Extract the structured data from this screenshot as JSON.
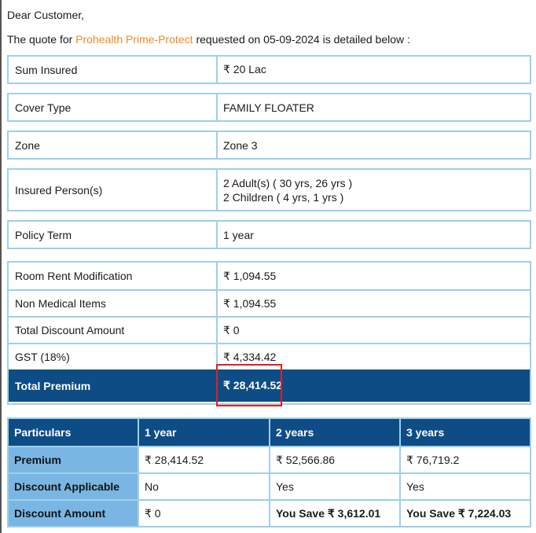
{
  "greeting": "Dear Customer,",
  "intro": {
    "prefix": "The quote for ",
    "product": "Prohealth Prime-Protect",
    "middle": " requested on ",
    "date": "05-09-2024",
    "suffix": " is detailed below :"
  },
  "details": {
    "sum_insured": {
      "label": "Sum Insured",
      "value": "₹ 20 Lac"
    },
    "cover_type": {
      "label": "Cover Type",
      "value": "FAMILY FLOATER"
    },
    "zone": {
      "label": "Zone",
      "value": "Zone 3"
    },
    "insured_persons": {
      "label": "Insured Person(s)",
      "line1": "2 Adult(s) ( 30 yrs, 26 yrs )",
      "line2": "2 Children ( 4 yrs, 1 yrs )"
    },
    "policy_term": {
      "label": "Policy Term",
      "value": "1 year"
    }
  },
  "charges": {
    "room_rent": {
      "label": "Room Rent Modification",
      "value": "₹ 1,094.55"
    },
    "non_medical": {
      "label": "Non Medical Items",
      "value": "₹ 1,094.55"
    },
    "discount": {
      "label": "Total Discount Amount",
      "value": "₹ 0"
    },
    "gst": {
      "label": "GST (18%)",
      "value": "₹ 4,334.42"
    },
    "total": {
      "label": "Total Premium",
      "value": "₹ 28,414.52"
    }
  },
  "particulars": {
    "headers": [
      "Particulars",
      "1 year",
      "2 years",
      "3 years"
    ],
    "premium": {
      "label": "Premium",
      "values": [
        "₹ 28,414.52",
        "₹ 52,566.86",
        "₹ 76,719.2"
      ]
    },
    "discount_applicable": {
      "label": "Discount Applicable",
      "values": [
        "No",
        "Yes",
        "Yes"
      ]
    },
    "discount_amount": {
      "label": "Discount Amount",
      "values": [
        "₹ 0",
        "You Save ₹ 3,612.01",
        "You Save ₹ 7,224.03"
      ]
    }
  },
  "colors": {
    "accent_orange": "#f08a24",
    "header_navy": "#0e4c86",
    "label_blue": "#7ab6e4",
    "border_light_blue": "#9fd0e8",
    "highlight_red": "#e02020"
  }
}
